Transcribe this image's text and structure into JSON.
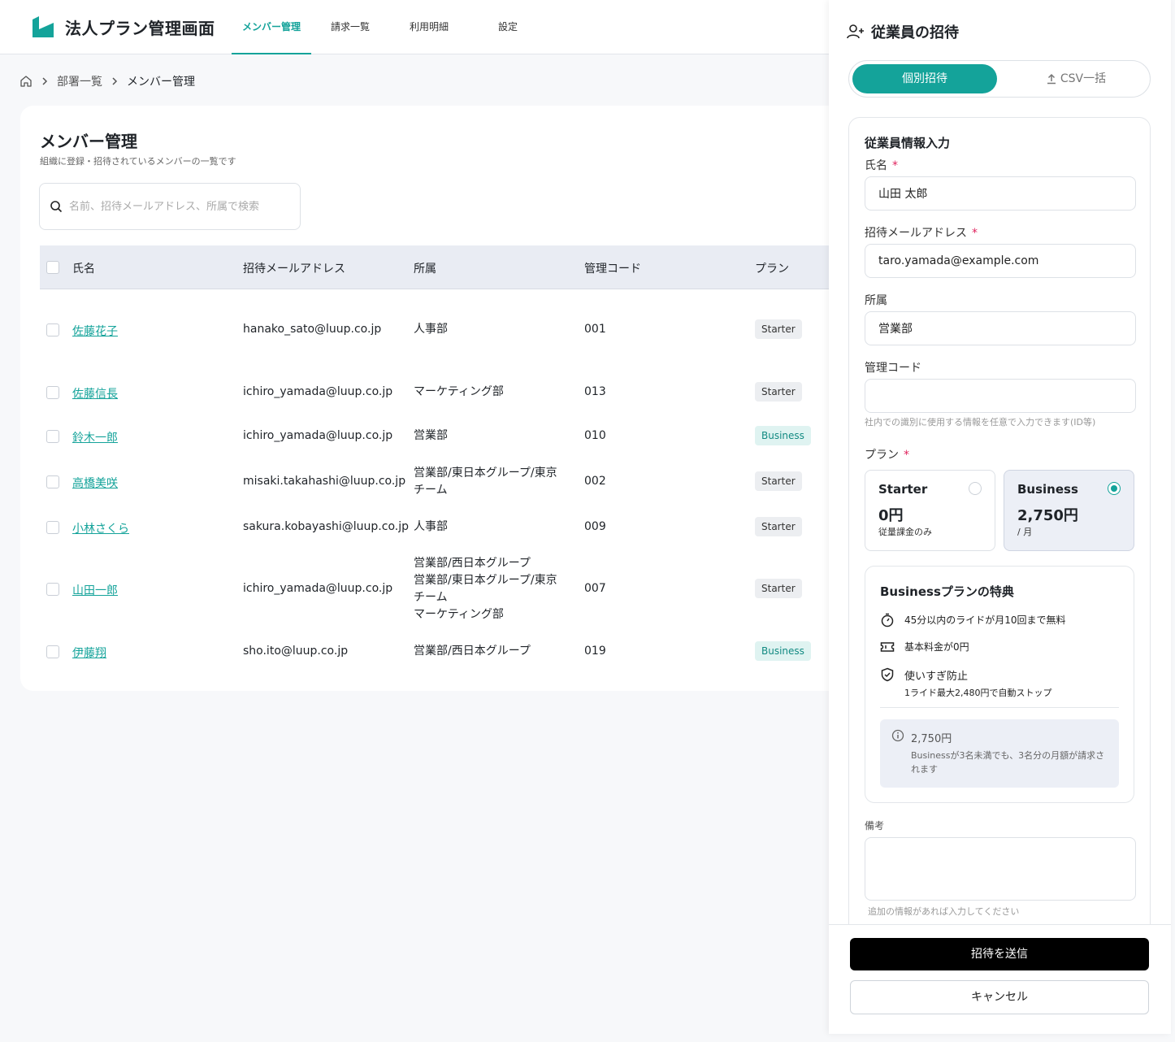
{
  "header": {
    "app_title": "法人プラン管理画面",
    "tabs": [
      {
        "label": "メンバー管理",
        "active": true
      },
      {
        "label": "請求一覧",
        "active": false
      },
      {
        "label": "利用明細",
        "active": false
      },
      {
        "label": "設定",
        "active": false
      }
    ]
  },
  "breadcrumb": {
    "items": [
      "部署一覧",
      "メンバー管理"
    ]
  },
  "members": {
    "title": "メンバー管理",
    "subtitle": "組織に登録・招待されているメンバーの一覧です",
    "search_placeholder": "名前、招待メールアドレス、所属で検索",
    "columns": [
      "氏名",
      "招待メールアドレス",
      "所属",
      "管理コード",
      "プラン"
    ],
    "rows": [
      {
        "name": "佐藤花子",
        "email": "hanako_sato@luup.co.jp",
        "dept": [
          "人事部"
        ],
        "code": "001",
        "plan": "Starter"
      },
      {
        "name": "佐藤信長",
        "email": "ichiro_yamada@luup.co.jp",
        "dept": [
          "マーケティング部"
        ],
        "code": "013",
        "plan": "Starter"
      },
      {
        "name": "鈴木一郎",
        "email": "ichiro_yamada@luup.co.jp",
        "dept": [
          "営業部"
        ],
        "code": "010",
        "plan": "Business"
      },
      {
        "name": "高橋美咲",
        "email": "misaki.takahashi@luup.co.jp",
        "dept": [
          "営業部/東日本グループ/東京",
          "チーム"
        ],
        "code": "002",
        "plan": "Starter"
      },
      {
        "name": "小林さくら",
        "email": "sakura.kobayashi@luup.co.jp",
        "dept": [
          "人事部"
        ],
        "code": "009",
        "plan": "Starter"
      },
      {
        "name": "山田一郎",
        "email": "ichiro_yamada@luup.co.jp",
        "dept": [
          "営業部/西日本グループ",
          "営業部/東日本グループ/東京",
          "チーム",
          "マーケティング部"
        ],
        "code": "007",
        "plan": "Starter"
      },
      {
        "name": "伊藤翔",
        "email": "sho.ito@luup.co.jp",
        "dept": [
          "営業部/西日本グループ"
        ],
        "code": "019",
        "plan": "Business"
      }
    ]
  },
  "invite": {
    "title": "従業員の招待",
    "toggle": {
      "individual": "個別招待",
      "csv": "CSV一括"
    },
    "section_title": "従業員情報入力",
    "name_label": "氏名",
    "name_value": "山田 太郎",
    "email_label": "招待メールアドレス",
    "email_value": "taro.yamada@example.com",
    "dept_label": "所属",
    "dept_value": "営業部",
    "code_label": "管理コード",
    "code_value": "",
    "code_hint": "社内での識別に使用する情報を任意で入力できます(ID等)",
    "plan_label": "プラン",
    "required_mark": "*",
    "plans": {
      "starter": {
        "name": "Starter",
        "price": "0円",
        "note": "従量課金のみ"
      },
      "business": {
        "name": "Business",
        "price": "2,750円",
        "note": "/ 月"
      }
    },
    "benefits": {
      "title": "Businessプランの特典",
      "item1": "45分以内のライドが月10回まで無料",
      "item2": "基本料金が0円",
      "item3_title": "使いすぎ防止",
      "item3_sub": "1ライド最大2,480円で自動ストップ",
      "info_amount": "2,750円",
      "info_text": "Businessが3名未満でも、3名分の月額が請求されます"
    },
    "notes_label": "備考",
    "notes_hint": "追加の情報があれば入力してください",
    "submit_label": "招待を送信",
    "cancel_label": "キャンセル"
  },
  "colors": {
    "accent": "#14a39a",
    "business_badge_bg": "#dff3f1",
    "starter_badge_bg": "#eceef1"
  }
}
